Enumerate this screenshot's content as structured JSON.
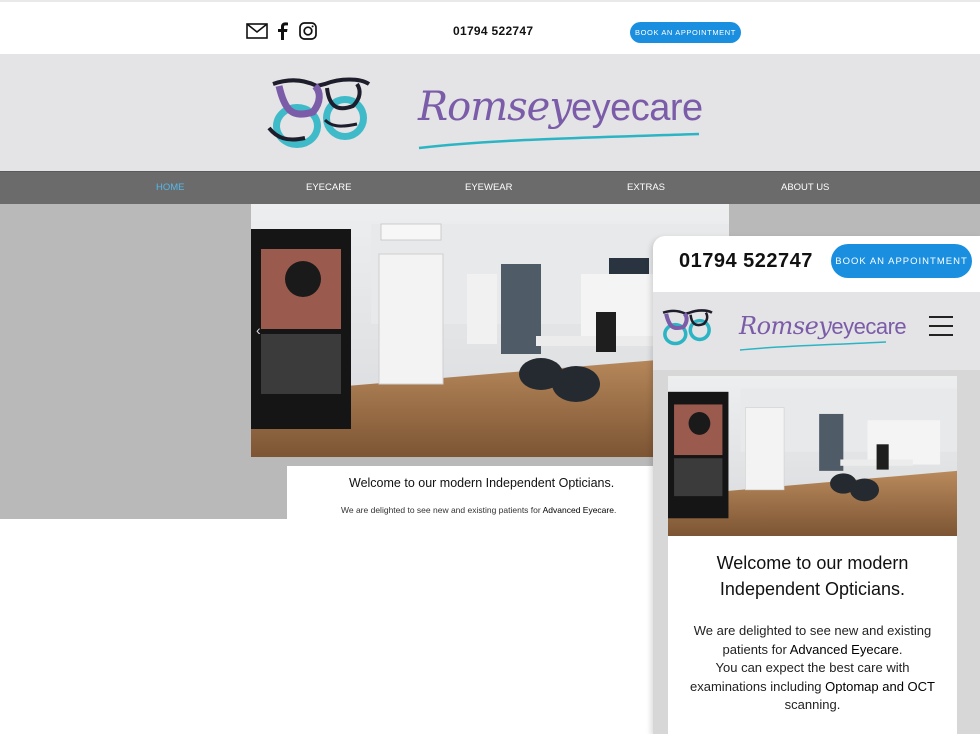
{
  "topbar": {
    "phone": "01794 522747",
    "book_label": "BOOK AN APPOINTMENT",
    "social_icons": [
      "mail-icon",
      "facebook-icon",
      "instagram-icon"
    ]
  },
  "brand": {
    "script_part": "Romsey",
    "sans_part": "eyecare",
    "colors": {
      "purple": "#7a5ca8",
      "teal": "#2bb5c4",
      "accent_blue": "#1a8fe0",
      "nav_active": "#55b8ea",
      "nav_bg": "#6b6b6b"
    }
  },
  "nav": {
    "items": [
      {
        "label": "HOME",
        "active": true
      },
      {
        "label": "EYECARE"
      },
      {
        "label": "EYEWEAR"
      },
      {
        "label": "EXTRAS"
      },
      {
        "label": "ABOUT US"
      }
    ]
  },
  "welcome": {
    "title": "Welcome to our modern Independent Opticians.",
    "sub_prefix": "We are delighted to see new and existing patients for ",
    "sub_strong": "Advanced Eyecare",
    "sub_suffix": "."
  },
  "mobile": {
    "phone": "01794 522747",
    "book_label": "BOOK AN APPOINTMENT",
    "title_line1": "Welcome to our modern",
    "title_line2": "Independent Opticians.",
    "body_line1": "We are delighted to see new and existing",
    "body_line2_prefix": "patients for ",
    "body_line2_strong": "Advanced Eyecare",
    "body_line2_suffix": ".",
    "body_line3": "You can expect the best care with",
    "body_line4_prefix": "examinations including ",
    "body_line4_strong": "Optomap and OCT",
    "body_line5": "scanning."
  }
}
